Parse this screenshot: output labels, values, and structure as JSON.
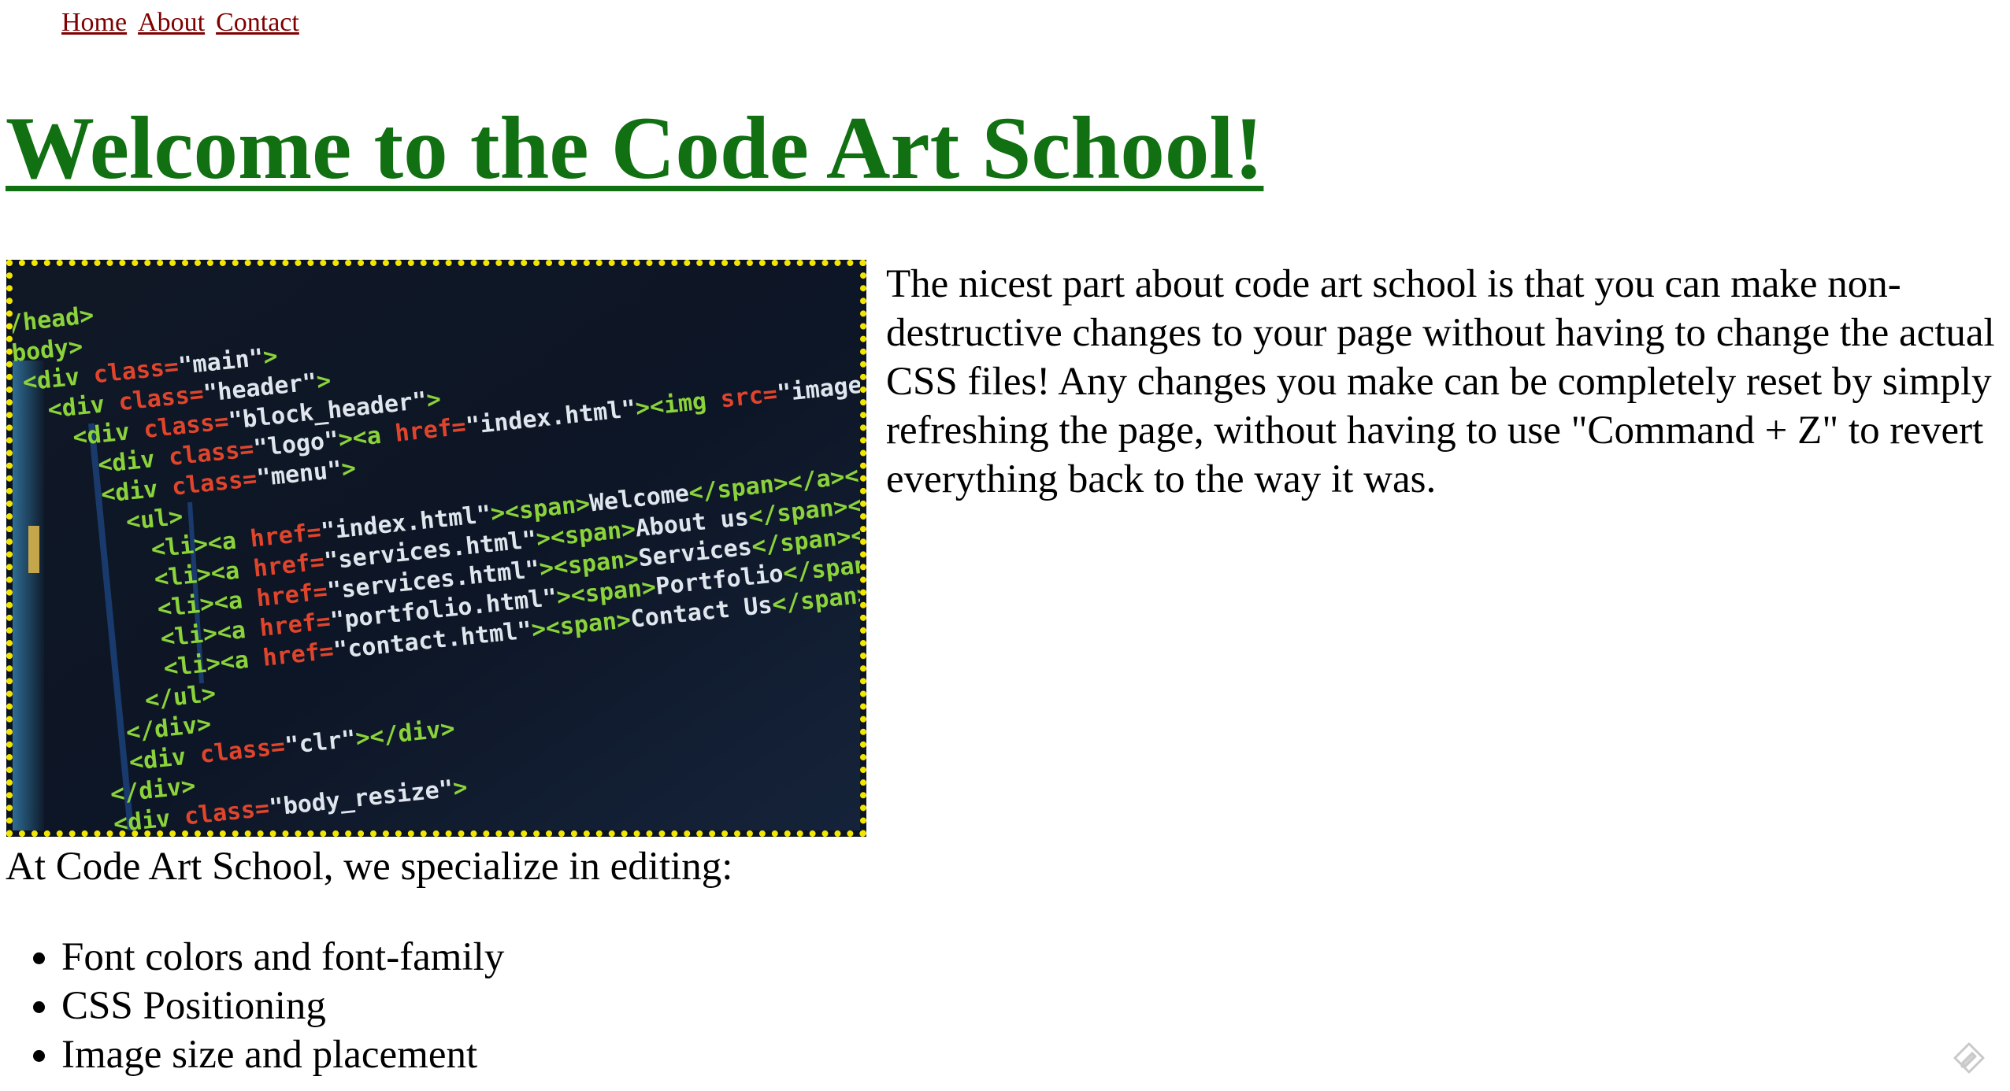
{
  "nav": {
    "items": [
      {
        "label": "Home"
      },
      {
        "label": "About"
      },
      {
        "label": "Contact"
      }
    ]
  },
  "page": {
    "title": "Welcome to the Code Art School!",
    "intro": "The nicest part about code art school is that you can make non-destructive changes to your page without having to change the actual CSS files! Any changes you make can be completely reset by simply refreshing the page, without having to use \"Command + Z\" to revert everything back to the way it was.",
    "specialize": "At Code Art School, we specialize in editing:",
    "features": [
      "Font colors and font-family",
      "CSS Positioning",
      "Image size and placement"
    ]
  },
  "hero_image": {
    "description_icon": "code-screenshot-image",
    "code_lines": [
      "</head>",
      "<body>",
      "<div class=\"main\">",
      "<div class=\"header\">",
      "<div class=\"block_header\">",
      "<div class=\"logo\"><a href=\"index.html\"><img src=\"images/logo.gif\"",
      "<div class=\"menu\">",
      "<ul>",
      "<li><a href=\"index.html\"><span>Welcome</span></a></li>",
      "<li><a href=\"services.html\"><span>About us</span></a></li>",
      "<li><a href=\"services.html\"><span>Services</span></a></li>",
      "<li><a href=\"portfolio.html\"><span>Portfolio</span></a></li>",
      "<li><a href=\"contact.html\"><span>Contact Us</span></a></li>",
      "</ul>",
      "</div>",
      "<div class=\"clr\"></div>",
      "</div>",
      "<div class=\"body_resize\">"
    ]
  },
  "colors": {
    "title": "#117011",
    "nav_link": "#800000",
    "image_border": "#f2e600",
    "code_tag": "#8bd33a",
    "code_attr": "#e0452c",
    "code_text": "#dfe6ee"
  },
  "icons": {
    "corner": "edit-pencil-icon"
  }
}
